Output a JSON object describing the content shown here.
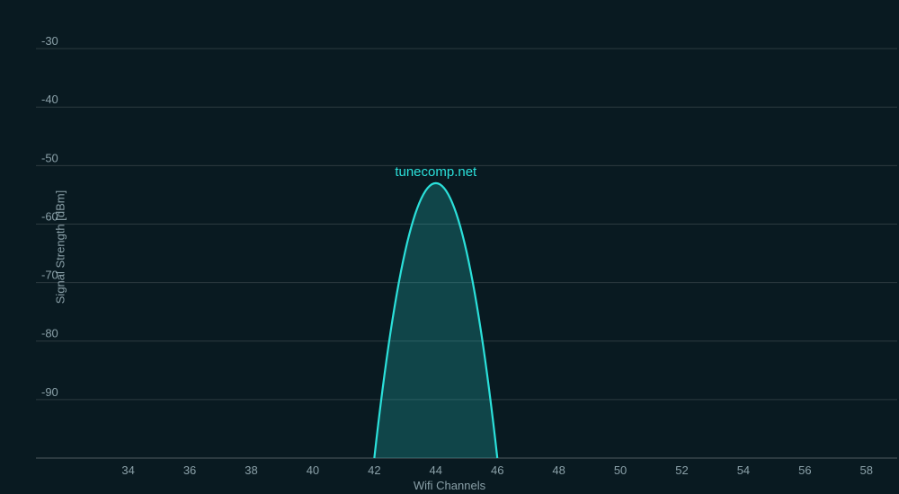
{
  "chart_data": {
    "type": "area",
    "xlabel": "Wifi Channels",
    "ylabel": "Signal Strength [dBm]",
    "x_ticks": [
      34,
      36,
      38,
      40,
      42,
      44,
      46,
      48,
      50,
      52,
      54,
      56,
      58
    ],
    "y_ticks": [
      -30,
      -40,
      -50,
      -60,
      -70,
      -80,
      -90
    ],
    "xlim": [
      31,
      59
    ],
    "ylim": [
      -100,
      -22
    ],
    "series": [
      {
        "name": "tunecomp.net",
        "color": "#2be0da",
        "channel": 44,
        "peak_dbm": -53,
        "half_width_channels": 2
      }
    ]
  }
}
